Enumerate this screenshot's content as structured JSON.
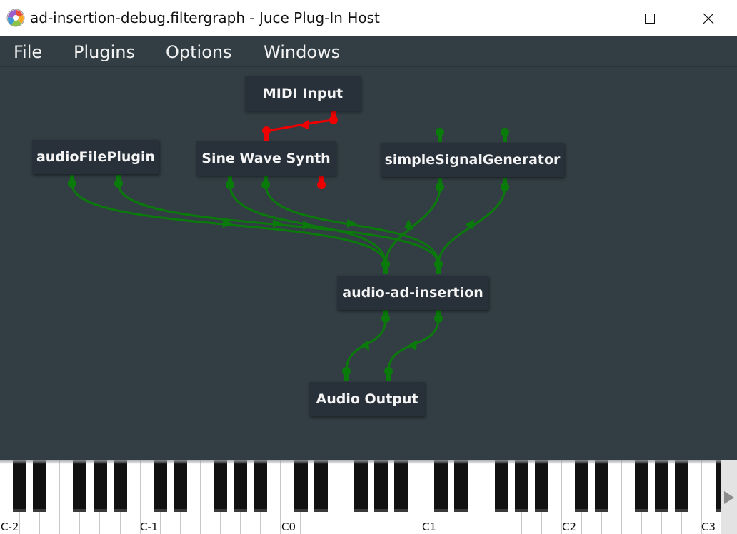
{
  "window": {
    "title": "ad-insertion-debug.filtergraph - Juce Plug-In Host",
    "controls": [
      "minimize",
      "maximize",
      "close"
    ]
  },
  "menu": {
    "file": "File",
    "plugins": "Plugins",
    "options": "Options",
    "windows": "Windows"
  },
  "graph": {
    "nodes": {
      "midi_input": "MIDI Input",
      "audio_file_plugin": "audioFilePlugin",
      "sine_wave_synth": "Sine Wave Synth",
      "simple_signal_generator": "simpleSignalGenerator",
      "audio_ad_insertion": "audio-ad-insertion",
      "audio_output": "Audio Output"
    },
    "colors": {
      "background": "#323e44",
      "node": "#28313a",
      "audio_connection": "#0a7a0a",
      "midi_connection": "#ee0000"
    }
  },
  "keyboard": {
    "octave_labels": [
      "C-2",
      "C-1",
      "C0",
      "C1",
      "C2",
      "C3"
    ]
  }
}
